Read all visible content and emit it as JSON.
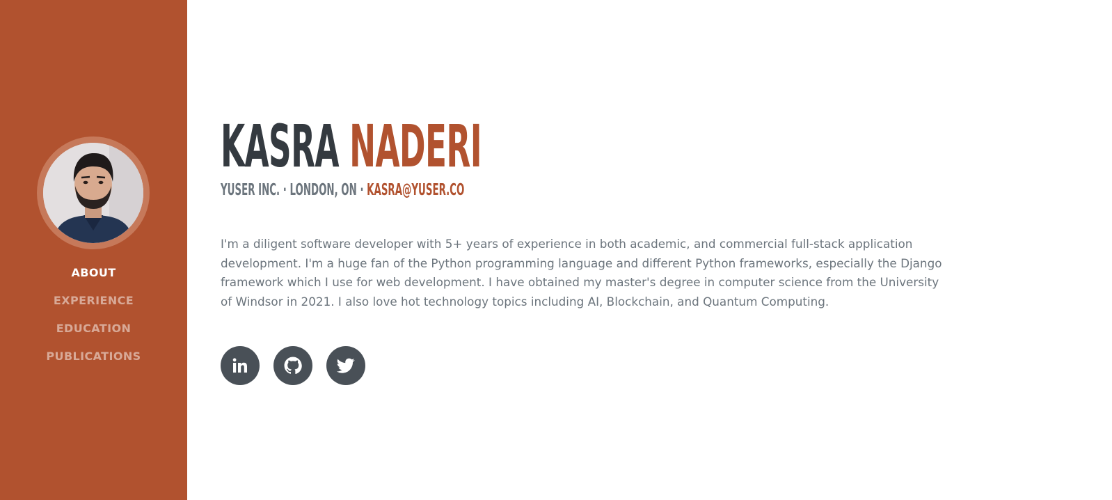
{
  "profile": {
    "first_name": "KASRA",
    "last_name": "NADERI",
    "company": "YUSER INC.",
    "location": "LONDON, ON",
    "separator": " · ",
    "email": "KASRA@YUSER.CO",
    "bio": "I'm a diligent software developer with 5+ years of experience in both academic, and commercial full-stack application development. I'm a huge fan of the Python programming language and different Python frameworks, especially the Django framework which I use for web development. I have obtained my master's degree in computer science from the University of Windsor in 2021. I also love hot technology topics including AI, Blockchain, and Quantum Computing."
  },
  "nav": {
    "items": [
      {
        "label": "ABOUT",
        "active": true
      },
      {
        "label": "EXPERIENCE",
        "active": false
      },
      {
        "label": "EDUCATION",
        "active": false
      },
      {
        "label": "PUBLICATIONS",
        "active": false
      }
    ]
  },
  "socials": [
    {
      "icon": "linkedin-icon"
    },
    {
      "icon": "github-icon"
    },
    {
      "icon": "twitter-icon"
    }
  ],
  "colors": {
    "primary": "#b1522f",
    "dark": "#343a40",
    "muted": "#6c757d",
    "icon_bg": "#495057"
  }
}
